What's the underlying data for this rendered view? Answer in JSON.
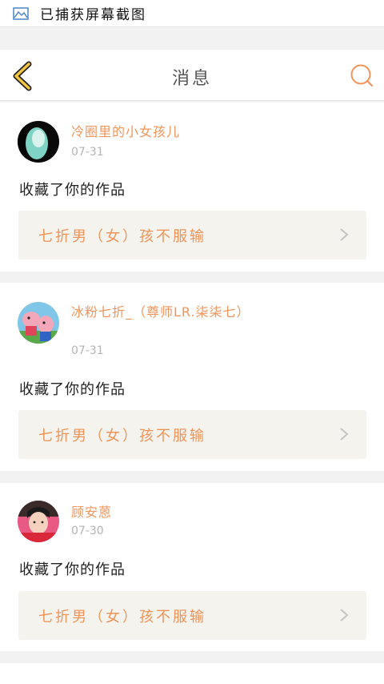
{
  "status_bar": {
    "text": "已捕获屏幕截图",
    "icon": "screenshot-icon"
  },
  "header": {
    "title": "消息",
    "back_icon": "chevron-left-icon",
    "search_icon": "search-icon"
  },
  "colors": {
    "accent": "#f0955c",
    "back_arrow": "#f2c542",
    "card_bg": "#f4f3ee",
    "page_bg": "#f2f2f2"
  },
  "messages": [
    {
      "user": "冷圈里的小女孩儿",
      "date": "07-31",
      "action": "收藏了你的作品",
      "work": "七折男（女）孩不服输"
    },
    {
      "user": "冰粉七折_（尊师LR.柒柒七）",
      "date": "07-31",
      "action": "收藏了你的作品",
      "work": "七折男（女）孩不服输"
    },
    {
      "user": "顾安蒽",
      "date": "07-30",
      "action": "收藏了你的作品",
      "work": "七折男（女）孩不服输"
    }
  ]
}
